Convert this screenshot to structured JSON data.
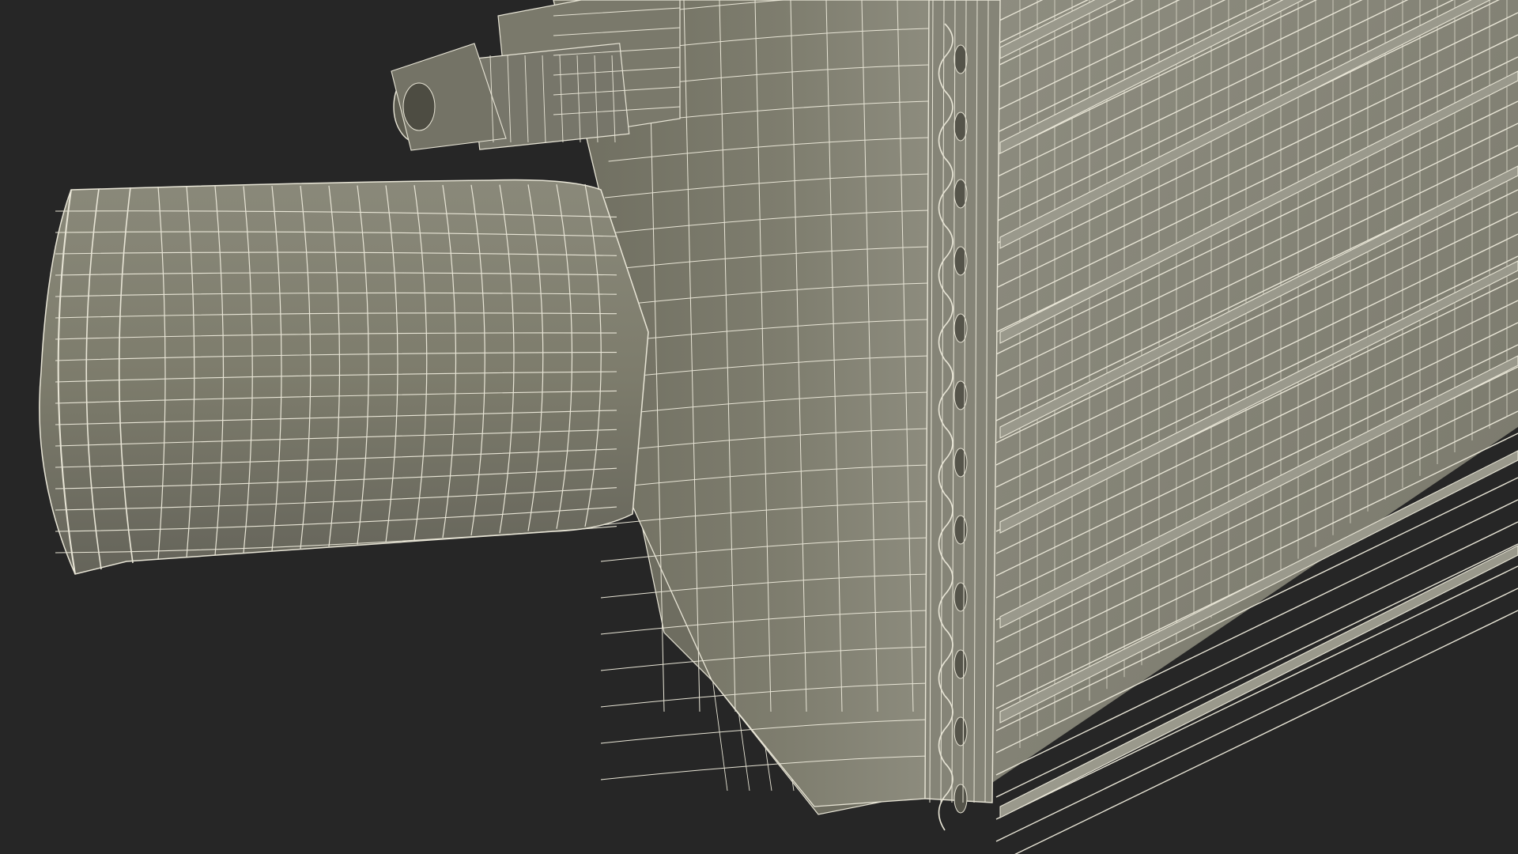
{
  "scene": {
    "subject": "intercooler-wireframe-render",
    "background_color": "#262626",
    "surface_color": "#7d7c6c",
    "surface_shadow_color": "#5f5e51",
    "surface_highlight_color": "#97968a",
    "wire_color": "#e8e5d6",
    "visible_parts": [
      "inlet-pipe",
      "end-tank",
      "sensor-connector",
      "core-fins",
      "mounting-bracket"
    ]
  }
}
